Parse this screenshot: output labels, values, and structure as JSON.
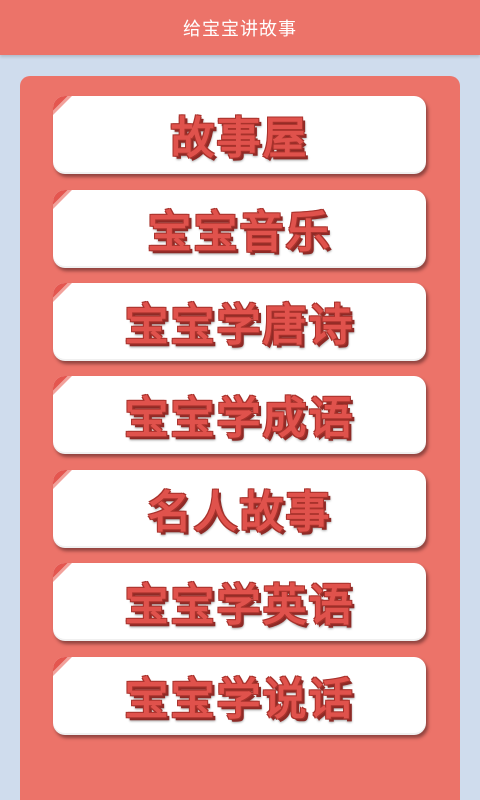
{
  "header": {
    "title": "给宝宝讲故事"
  },
  "menu": {
    "items": [
      {
        "label": "故事屋"
      },
      {
        "label": "宝宝音乐"
      },
      {
        "label": "宝宝学唐诗"
      },
      {
        "label": "宝宝学成语"
      },
      {
        "label": "名人故事"
      },
      {
        "label": "宝宝学英语"
      },
      {
        "label": "宝宝学说话"
      }
    ]
  },
  "colors": {
    "background": "#cfdced",
    "accent": "#ec7369",
    "label": "#e0524c",
    "ribbon": "#e4564f"
  }
}
